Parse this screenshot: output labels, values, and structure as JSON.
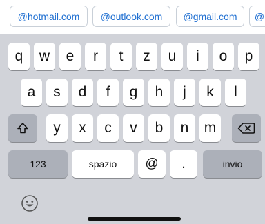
{
  "suggestions": [
    "@hotmail.com",
    "@outlook.com",
    "@gmail.com",
    "@"
  ],
  "rows": {
    "row1": [
      "q",
      "w",
      "e",
      "r",
      "t",
      "z",
      "u",
      "i",
      "o",
      "p"
    ],
    "row2": [
      "a",
      "s",
      "d",
      "f",
      "g",
      "h",
      "j",
      "k",
      "l"
    ],
    "row3": [
      "y",
      "x",
      "c",
      "v",
      "b",
      "n",
      "m"
    ]
  },
  "bottom": {
    "numbers_label": "123",
    "space_label": "spazio",
    "at_label": "@",
    "dot_label": ".",
    "return_label": "invio"
  },
  "icons": {
    "shift": "shift-icon",
    "backspace": "backspace-icon",
    "emoji": "emoji-icon"
  }
}
